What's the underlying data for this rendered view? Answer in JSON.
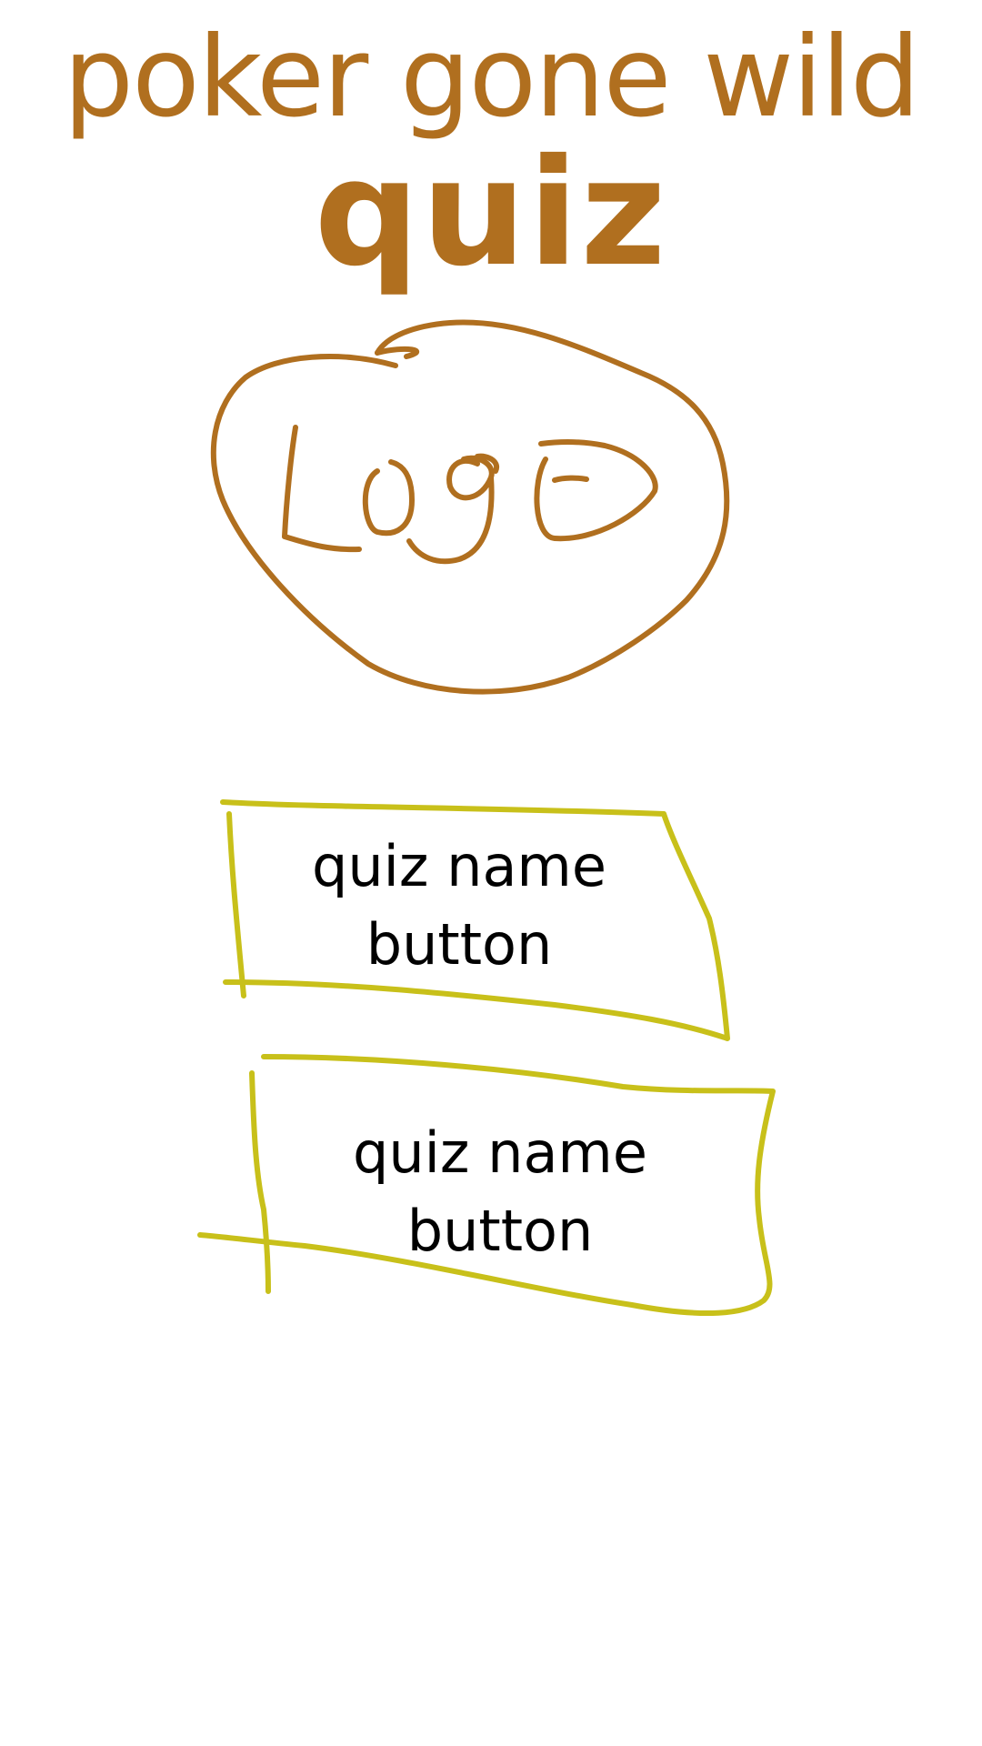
{
  "header": {
    "title_line1": "poker gone wild",
    "title_line2": "quiz"
  },
  "logo": {
    "text": "Logo",
    "color": "#b06f1f"
  },
  "quiz_buttons": [
    {
      "line1": "quiz name",
      "line2": "button"
    },
    {
      "line1": "quiz name",
      "line2": "button"
    }
  ],
  "colors": {
    "title": "#b06f1f",
    "button_outline": "#c8c01a",
    "button_text": "#000000",
    "background": "#ffffff"
  }
}
